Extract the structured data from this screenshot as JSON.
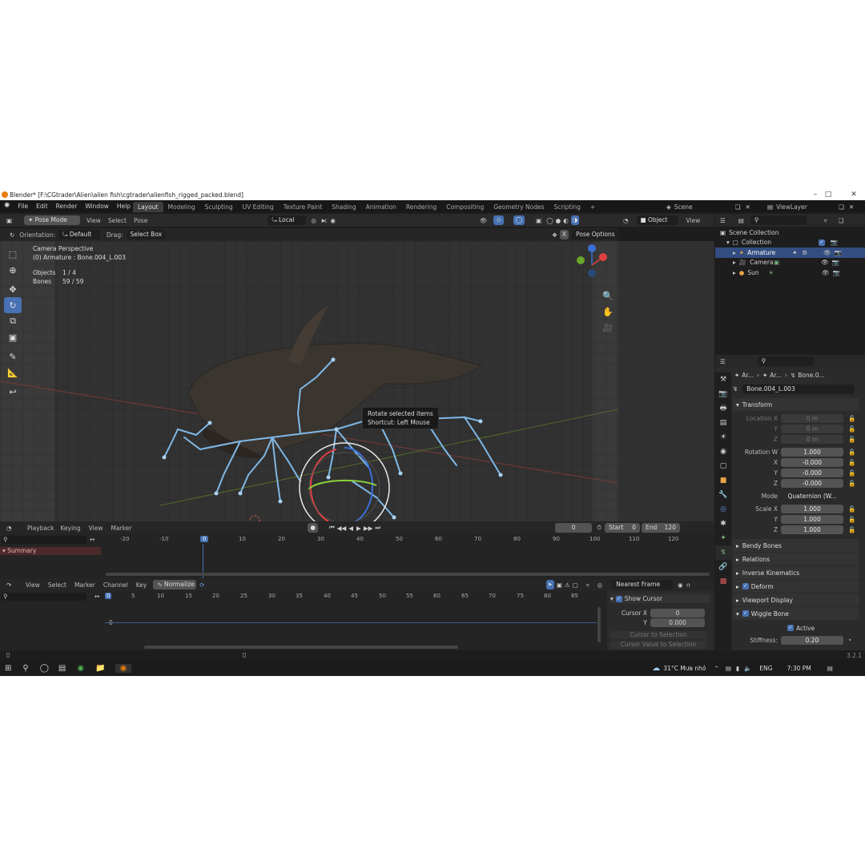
{
  "window": {
    "title": "Blender* [F:\\CGtrader\\Alien\\alien fish\\cgtrader\\alienfish_rigged_packed.blend]",
    "min": "–",
    "max": "□",
    "close": "✕"
  },
  "menu": {
    "items": [
      "File",
      "Edit",
      "Render",
      "Window",
      "Help"
    ]
  },
  "workspaces": [
    "Layout",
    "Modeling",
    "Sculpting",
    "UV Editing",
    "Texture Paint",
    "Shading",
    "Animation",
    "Rendering",
    "Compositing",
    "Geometry Nodes",
    "Scripting",
    "+"
  ],
  "scene": {
    "label": "Scene",
    "viewlayer": "ViewLayer"
  },
  "viewport_header": {
    "mode": "Pose Mode",
    "menus": [
      "View",
      "Select",
      "Pose"
    ],
    "pivot": "Local",
    "object_label": "Object",
    "view_label": "View"
  },
  "tool_settings": {
    "orientation_label": "Orientation:",
    "orientation_value": "Default",
    "drag_label": "Drag:",
    "drag_value": "Select Box",
    "x_label": "X",
    "pose_options": "Pose Options"
  },
  "overlay": {
    "view_name": "Camera Perspective",
    "active": "(0) Armature : Bone.004_L.003",
    "objects_label": "Objects",
    "objects_value": "1 / 4",
    "bones_label": "Bones",
    "bones_value": "59 / 59"
  },
  "tooltip": {
    "line1": "Rotate selected items",
    "line2": "Shortcut: Left Mouse"
  },
  "outliner": {
    "root": "Scene Collection",
    "collection": "Collection",
    "items": [
      "Armature",
      "Camera",
      "Sun"
    ]
  },
  "properties": {
    "breadcrumb": [
      "Ar...",
      "Ar...",
      "Bone.0..."
    ],
    "bone_name": "Bone.004_L.003",
    "transform": "Transform",
    "location": {
      "label": "Location X",
      "x": "0 m",
      "y": "0 m",
      "z": "0 m"
    },
    "axes": {
      "x": "X",
      "y": "Y",
      "z": "Z"
    },
    "rotation": {
      "label": "Rotation W",
      "w": "1.000",
      "x": "-0.000",
      "y": "-0.000",
      "z": "-0.000"
    },
    "mode": {
      "label": "Mode",
      "value": "Quaternion (W..."
    },
    "scale": {
      "label": "Scale X",
      "x": "1.000",
      "y": "1.000",
      "z": "1.000"
    },
    "sections": [
      "Bendy Bones",
      "Relations",
      "Inverse Kinematics",
      "Deform",
      "Viewport Display",
      "Wiggle Bone"
    ],
    "active_label": "Active",
    "stiffness": {
      "label": "Stiffness:",
      "value": "0.20"
    }
  },
  "timeline": {
    "menus": [
      "Playback",
      "Keying",
      "View",
      "Marker"
    ],
    "frame": "0",
    "start_label": "Start",
    "start": "0",
    "end_label": "End",
    "end": "120",
    "summary": "Summary",
    "ruler": [
      "-20",
      "-10",
      "0",
      "10",
      "20",
      "30",
      "40",
      "50",
      "60",
      "70",
      "80",
      "90",
      "100",
      "110",
      "120"
    ]
  },
  "graph": {
    "menus": [
      "View",
      "Select",
      "Marker",
      "Channel",
      "Key"
    ],
    "normalize": "Normalize",
    "snap": "Nearest Frame",
    "ruler": [
      "0",
      "5",
      "10",
      "15",
      "20",
      "25",
      "30",
      "35",
      "40",
      "45",
      "50",
      "55",
      "60",
      "65",
      "70",
      "75",
      "80",
      "85"
    ],
    "zero_label": "0",
    "show_cursor": "Show Cursor",
    "cursor_x_label": "Cursor X",
    "cursor_x": "0",
    "cursor_y_label": "Y",
    "cursor_y": "0.000",
    "cursor_to_sel": "Cursor to Selection",
    "cursor_val_to_sel": "Cursor Value to Selection"
  },
  "status": {
    "version": "3.2.1"
  },
  "taskbar": {
    "weather": "31°C  Mưa nhỏ",
    "lang": "ENG",
    "time": "7:30 PM"
  },
  "colors": {
    "accent": "#4772b3",
    "bone": "#7fb8e6",
    "background": "#1d1d1d",
    "blender_orange": "#e87d0d"
  }
}
